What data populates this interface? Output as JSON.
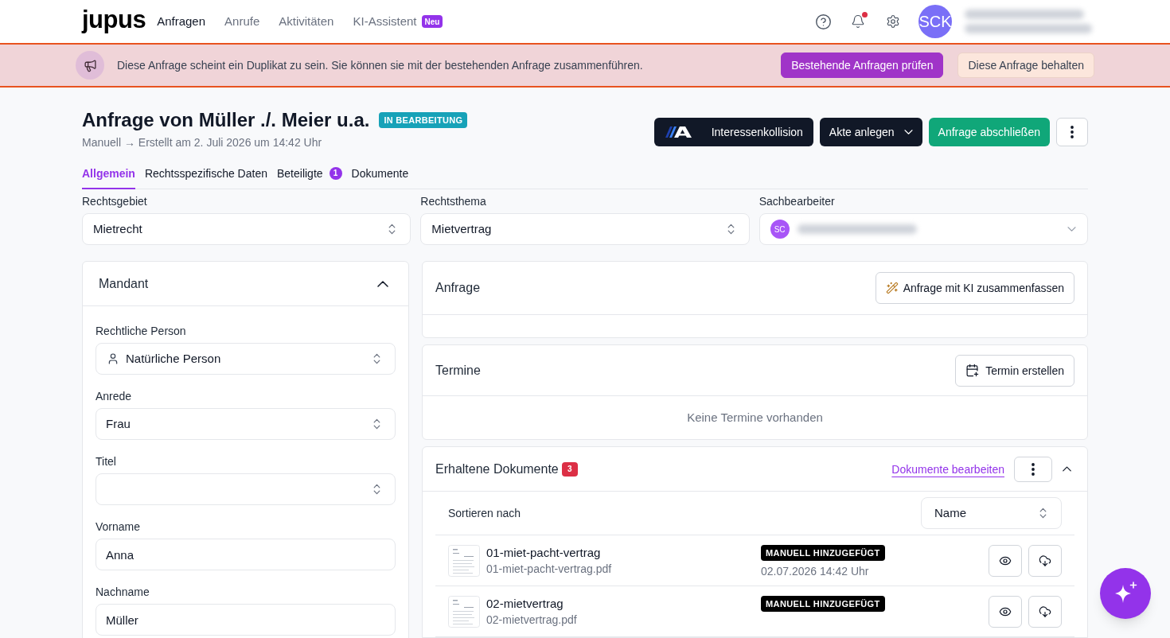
{
  "nav": {
    "logo": "jupus",
    "items": [
      {
        "label": "Anfragen",
        "selected": true
      },
      {
        "label": "Anrufe",
        "selected": false
      },
      {
        "label": "Aktivitäten",
        "selected": false
      },
      {
        "label": "KI-Assistent",
        "selected": false,
        "badge": "Neu"
      }
    ],
    "notifications_unread": true,
    "avatar": "SCK"
  },
  "banner": {
    "message": "Diese Anfrage scheint ein Duplikat zu sein. Sie können sie mit der bestehenden Anfrage zusammenführen.",
    "buttons": [
      {
        "label": "Bestehende Anfragen prüfen",
        "kind": "primary"
      },
      {
        "label": "Diese Anfrage behalten",
        "kind": "secondary"
      }
    ]
  },
  "header": {
    "title": "Anfrage von Müller ./. Meier u.a.",
    "status": "IN BEARBEITUNG",
    "subtitle": "Manuell → Erstellt am 2. Juli 2026 um 14:42 Uhr",
    "actions": [
      {
        "label": "Interessenkollision",
        "kind": "logo"
      },
      {
        "label": "Akte anlegen",
        "kind": "dropdown"
      },
      {
        "label": "Anfrage abschließen",
        "kind": "success"
      }
    ]
  },
  "tabs": [
    {
      "label": "Allgemein",
      "selected": true
    },
    {
      "label": "Rechtsspezifische Daten",
      "selected": false
    },
    {
      "label": "Beteiligte",
      "selected": false,
      "badge": "1"
    },
    {
      "label": "Dokumente",
      "selected": false
    }
  ],
  "fields": [
    {
      "label": "Rechtsgebiet",
      "value": "Mietrecht",
      "kind": "select"
    },
    {
      "label": "Rechtsthema",
      "value": "Mietvertrag",
      "kind": "select"
    },
    {
      "label": "Sachbearbeiter",
      "avatar": "SC",
      "kind": "user"
    }
  ],
  "client_panel": {
    "title": "Mandant",
    "expanded": true,
    "fields": [
      {
        "label": "Rechtliche Person",
        "value": "Natürliche Person",
        "kind": "select-person"
      },
      {
        "label": "Anrede",
        "value": "Frau",
        "kind": "select"
      },
      {
        "label": "Titel",
        "kind": "select"
      },
      {
        "label": "Vorname",
        "value": "Anna",
        "kind": "text"
      },
      {
        "label": "Nachname",
        "value": "Müller",
        "kind": "text"
      }
    ]
  },
  "request_panel": {
    "title": "Anfrage",
    "button": "Anfrage mit KI zusammenfassen"
  },
  "appointments_panel": {
    "title": "Termine",
    "button": "Termin erstellen",
    "empty": "Keine Termine vorhanden"
  },
  "documents_panel": {
    "title": "Erhaltene Dokumente",
    "count": "3",
    "edit_link": "Dokumente bearbeiten",
    "expanded": true,
    "sort_label": "Sortieren nach",
    "sort_value": "Name",
    "documents": [
      {
        "name": "01-miet-pacht-vertrag",
        "file": "01-miet-pacht-vertrag.pdf",
        "tag": "MANUELL HINZUGEFÜGT",
        "date": "02.07.2026 14:42 Uhr"
      },
      {
        "name": "02-mietvertrag",
        "file": "02-mietvertrag.pdf",
        "tag": "MANUELL HINZUGEFÜGT"
      }
    ]
  }
}
